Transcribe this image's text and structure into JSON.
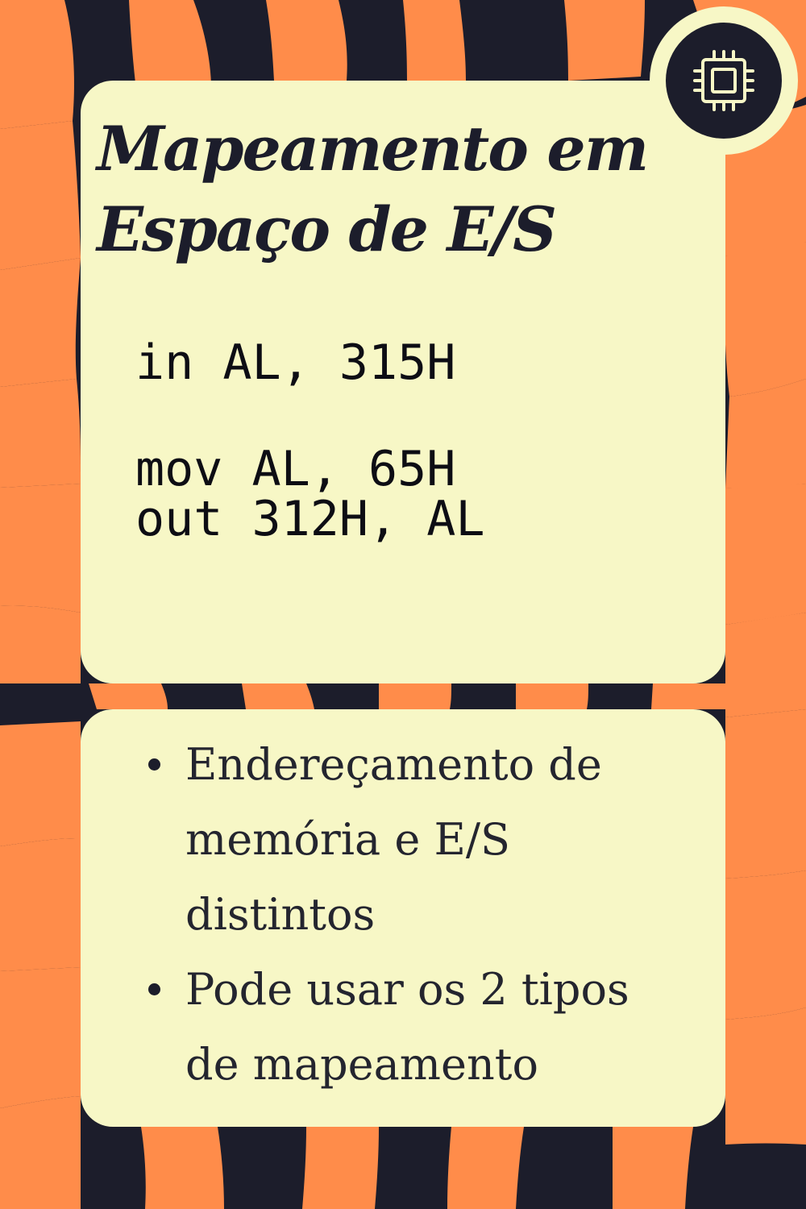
{
  "title": {
    "line1": "Mapeamento em",
    "line2": "Espaço de E/S"
  },
  "code": {
    "line1": "in AL, 315H",
    "line2": "mov AL, 65H",
    "line3": "out 312H, AL"
  },
  "bullets": [
    "Endereçamento de memória e E/S distintos",
    "Pode usar os 2 tipos de mapeamento"
  ],
  "icon": "cpu-chip-icon",
  "colors": {
    "dark": "#1c1d2b",
    "orange": "#ff8c4a",
    "cream": "#f7f7c6"
  }
}
